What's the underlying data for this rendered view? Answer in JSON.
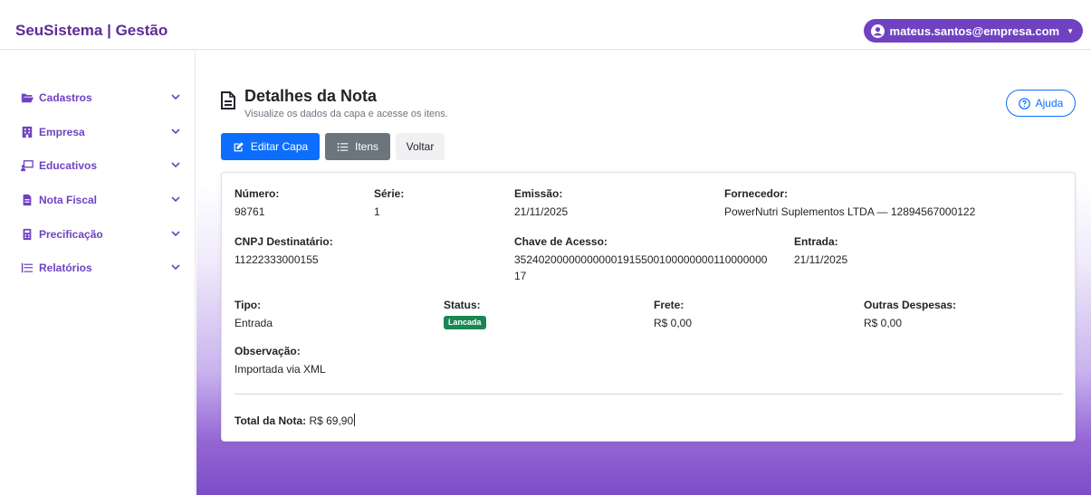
{
  "header": {
    "brand": "SeuSistema | Gestão",
    "user_email": "mateus.santos@empresa.com"
  },
  "sidebar": {
    "items": [
      {
        "label": "Cadastros",
        "icon": "folder-open-icon"
      },
      {
        "label": "Empresa",
        "icon": "building-icon"
      },
      {
        "label": "Educativos",
        "icon": "chalkboard-teacher-icon"
      },
      {
        "label": "Nota Fiscal",
        "icon": "file-invoice-icon"
      },
      {
        "label": "Precificação",
        "icon": "calculator-icon"
      },
      {
        "label": "Relatórios",
        "icon": "list-icon"
      }
    ]
  },
  "page": {
    "title": "Detalhes da Nota",
    "subtitle": "Visualize os dados da capa e acesse os itens.",
    "help_label": "Ajuda"
  },
  "actions": {
    "edit_label": "Editar Capa",
    "items_label": "Itens",
    "back_label": "Voltar"
  },
  "nota": {
    "numero_label": "Número:",
    "numero": "98761",
    "serie_label": "Série:",
    "serie": "1",
    "emissao_label": "Emissão:",
    "emissao": "21/11/2025",
    "fornecedor_label": "Fornecedor:",
    "fornecedor": "PowerNutri Suplementos LTDA — 12894567000122",
    "cnpj_label": "CNPJ Destinatário:",
    "cnpj": "11222333000155",
    "chave_label": "Chave de Acesso:",
    "chave_line1": "352402000000000001915500100000000110000000",
    "chave_line2": "17",
    "entrada_label": "Entrada:",
    "entrada": "21/11/2025",
    "tipo_label": "Tipo:",
    "tipo": "Entrada",
    "status_label": "Status:",
    "status": "Lancada",
    "frete_label": "Frete:",
    "frete": "R$ 0,00",
    "outras_label": "Outras Despesas:",
    "outras": "R$ 0,00",
    "obs_label": "Observação:",
    "obs": "Importada via XML",
    "total_label": "Total da Nota:",
    "total": "R$ 69,90"
  },
  "colors": {
    "brand": "#5e2b97",
    "accent": "#6f42c1",
    "primary": "#0d6efd",
    "secondary": "#6c757d",
    "success": "#198754"
  }
}
